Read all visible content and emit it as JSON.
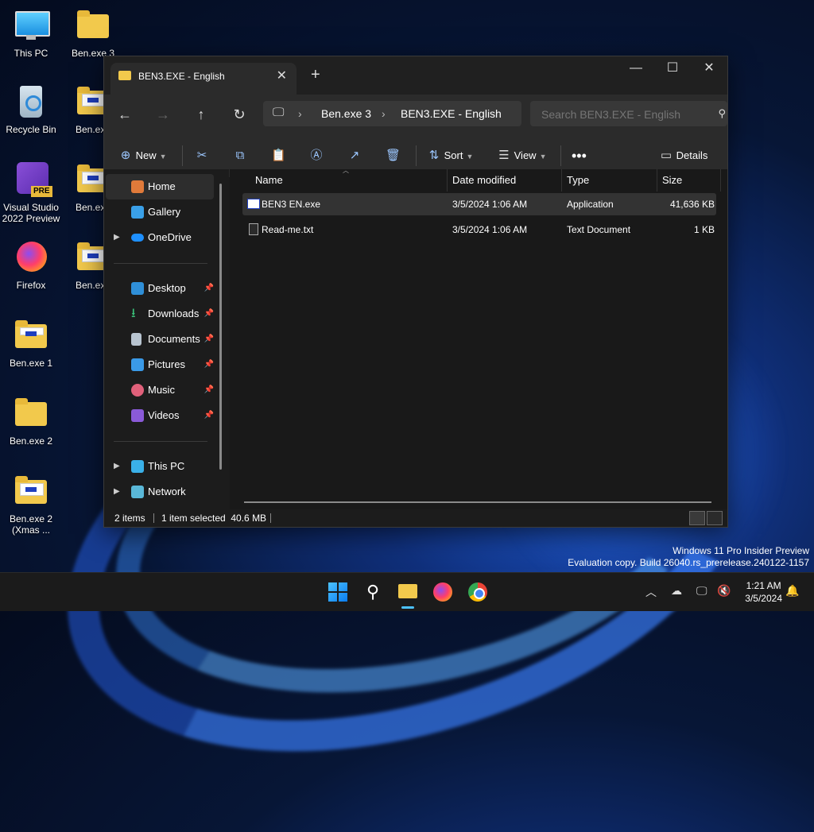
{
  "desktop": {
    "icons": [
      {
        "label": "This PC"
      },
      {
        "label": "Ben.exe 3"
      },
      {
        "label": "Recycle Bin"
      },
      {
        "label": "Ben.exe"
      },
      {
        "label": "Visual Studio 2022 Preview"
      },
      {
        "label": "Ben.exe"
      },
      {
        "label": "Firefox"
      },
      {
        "label": "Ben.exe"
      },
      {
        "label": "Ben.exe 1"
      },
      {
        "label": "Ben.exe 2"
      },
      {
        "label": "Ben.exe 2 (Xmas ..."
      }
    ],
    "vs_badge": "PRE"
  },
  "window": {
    "tab_title": "BEN3.EXE - English",
    "breadcrumb": [
      "Ben.exe 3",
      "BEN3.EXE - English"
    ],
    "search_placeholder": "Search BEN3.EXE - English",
    "toolbar": {
      "new_label": "New",
      "sort_label": "Sort",
      "view_label": "View",
      "details_label": "Details"
    },
    "sidebar": {
      "items": [
        {
          "label": "Home"
        },
        {
          "label": "Gallery"
        },
        {
          "label": "OneDrive"
        },
        {
          "label": "Desktop"
        },
        {
          "label": "Downloads"
        },
        {
          "label": "Documents"
        },
        {
          "label": "Pictures"
        },
        {
          "label": "Music"
        },
        {
          "label": "Videos"
        },
        {
          "label": "This PC"
        },
        {
          "label": "Network"
        }
      ]
    },
    "columns": [
      "Name",
      "Date modified",
      "Type",
      "Size"
    ],
    "files": [
      {
        "name": "BEN3 EN.exe",
        "date": "3/5/2024 1:06 AM",
        "type": "Application",
        "size": "41,636 KB"
      },
      {
        "name": "Read-me.txt",
        "date": "3/5/2024 1:06 AM",
        "type": "Text Document",
        "size": "1 KB"
      }
    ],
    "status": {
      "items": "2 items",
      "selected": "1 item selected  40.6 MB"
    }
  },
  "watermark": {
    "line1": "Windows 11 Pro Insider Preview",
    "line2": "Evaluation copy. Build 26040.rs_prerelease.240122-1157"
  },
  "clock": {
    "time": "1:21 AM",
    "date": "3/5/2024"
  },
  "colors": {
    "accent": "#4cc2ff",
    "folder": "#f2c94c"
  }
}
